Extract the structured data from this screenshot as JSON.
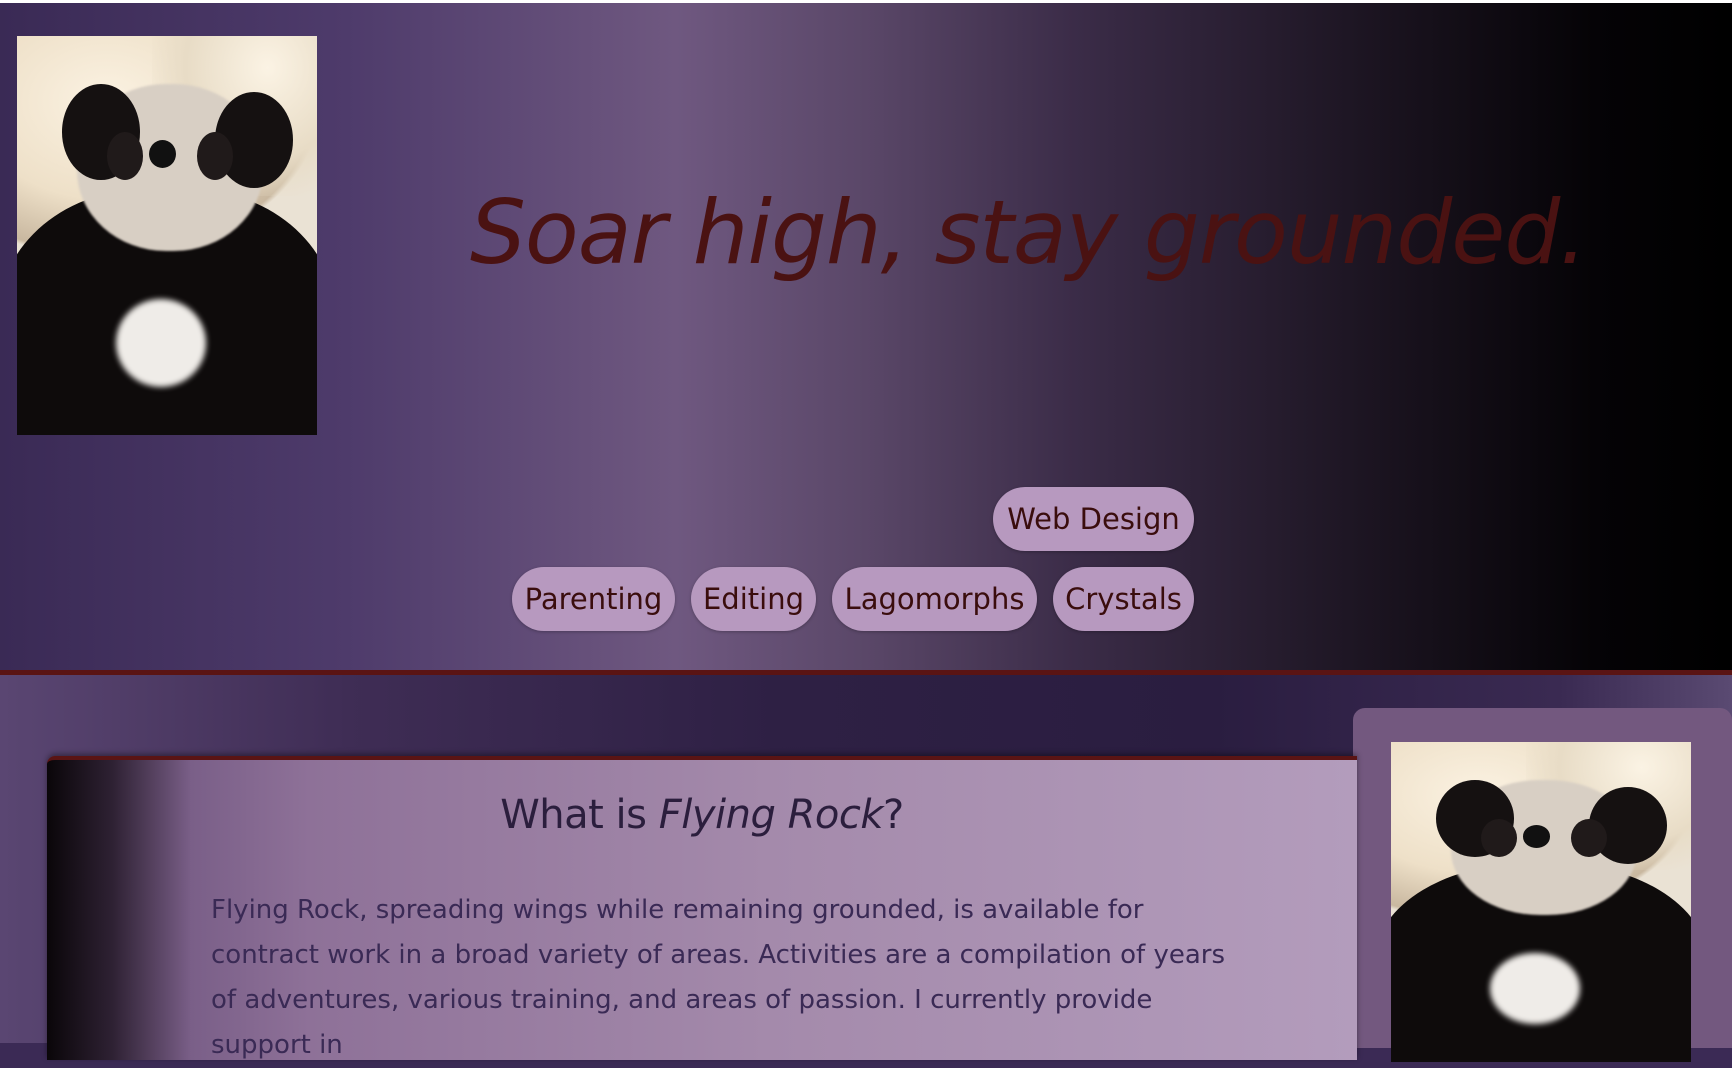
{
  "header": {
    "tagline": "Soar high, stay grounded.",
    "photo_alt": "panda plush photo"
  },
  "nav": {
    "items": [
      "Web Design",
      "Parenting",
      "Editing",
      "Lagomorphs",
      "Crystals"
    ]
  },
  "main": {
    "heading_prefix": "What is ",
    "heading_em": "Flying Rock",
    "heading_suffix": "?",
    "intro": "Flying Rock, spreading wings while remaining grounded, is available for contract work in a broad variety of areas. Activities are a compilation of years of adventures, various training, and areas of passion. I currently provide support in"
  },
  "colors": {
    "accent_dark_red": "#5a1414",
    "pill_bg": "#b799bf",
    "pill_text": "#3a0d0d"
  }
}
